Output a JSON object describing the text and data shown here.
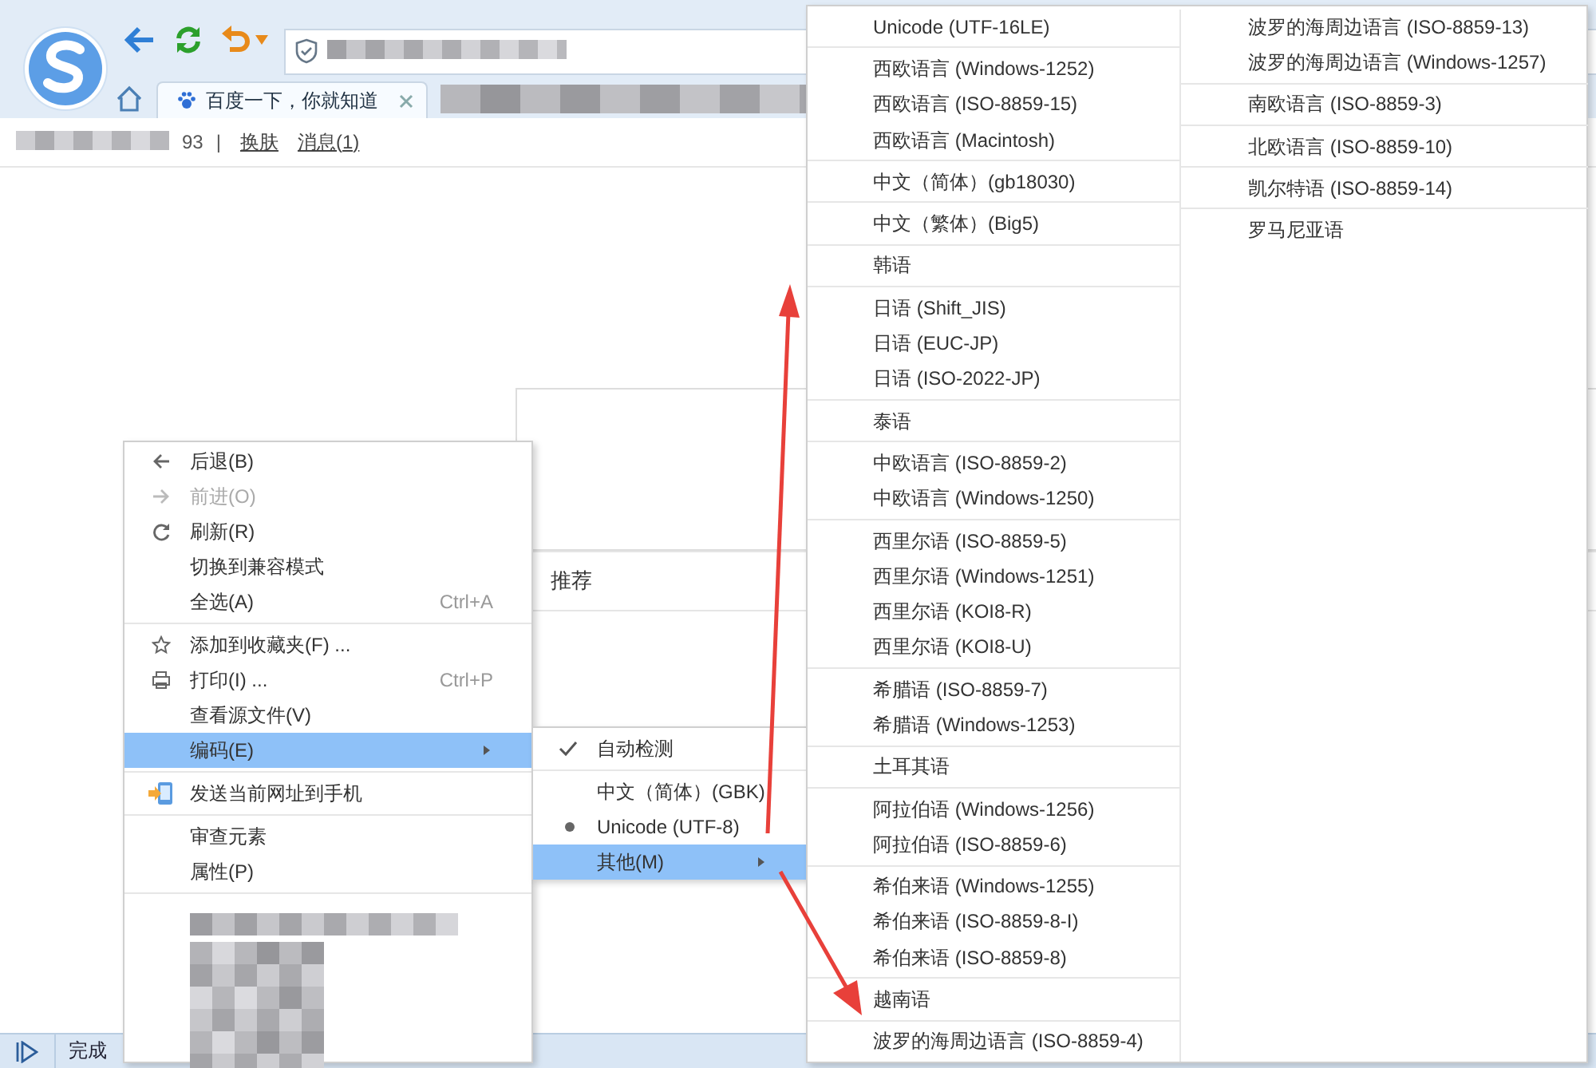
{
  "browser": {
    "tabs": [
      {
        "title": "百度一下，你就知道",
        "selected": true
      }
    ]
  },
  "user_bar": {
    "points": "93",
    "separator": "|",
    "links": [
      "换肤",
      "消息(1)"
    ]
  },
  "page": {
    "section_title": "推荐"
  },
  "context_menu": {
    "groups": [
      [
        {
          "label": "后退(B)",
          "disabled": false,
          "selected": false
        },
        {
          "label": "前进(O)",
          "disabled": true,
          "selected": false
        },
        {
          "label": "刷新(R)",
          "disabled": false,
          "selected": false
        },
        {
          "label": "切换到兼容模式",
          "disabled": false,
          "selected": false
        },
        {
          "label": "全选(A)",
          "shortcut": "Ctrl+A",
          "disabled": false,
          "selected": false
        }
      ],
      [
        {
          "label": "添加到收藏夹(F) ...",
          "disabled": false,
          "selected": false
        },
        {
          "label": "打印(I) ...",
          "shortcut": "Ctrl+P",
          "disabled": false,
          "selected": false
        },
        {
          "label": "查看源文件(V)",
          "disabled": false,
          "selected": false
        },
        {
          "label": "编码(E)",
          "submenu": true,
          "disabled": false,
          "selected": true
        }
      ],
      [
        {
          "label": "发送当前网址到手机",
          "disabled": false,
          "selected": false
        }
      ],
      [
        {
          "label": "审查元素",
          "disabled": false,
          "selected": false
        },
        {
          "label": "属性(P)",
          "disabled": false,
          "selected": false
        }
      ]
    ]
  },
  "encoding_submenu": {
    "groups": [
      [
        {
          "label": "自动检测",
          "kind": "checkbox",
          "checked": true,
          "selected": false
        }
      ],
      [
        {
          "label": "中文（简体）(GBK)",
          "kind": "radio",
          "checked": false,
          "selected": false
        },
        {
          "label": "Unicode (UTF-8)",
          "kind": "radio",
          "checked": true,
          "selected": false
        },
        {
          "label": "其他(M)",
          "kind": "submenu",
          "selected": true
        }
      ]
    ]
  },
  "other_encodings": {
    "columns": [
      [
        [
          "Unicode (UTF-16LE)"
        ],
        [
          "西欧语言 (Windows-1252)",
          "西欧语言 (ISO-8859-15)",
          "西欧语言 (Macintosh)"
        ],
        [
          "中文（简体）(gb18030)"
        ],
        [
          "中文（繁体）(Big5)"
        ],
        [
          "韩语"
        ],
        [
          "日语 (Shift_JIS)",
          "日语 (EUC-JP)",
          "日语 (ISO-2022-JP)"
        ],
        [
          "泰语"
        ],
        [
          "中欧语言 (ISO-8859-2)",
          "中欧语言 (Windows-1250)"
        ],
        [
          "西里尔语 (ISO-8859-5)",
          "西里尔语 (Windows-1251)",
          "西里尔语 (KOI8-R)",
          "西里尔语 (KOI8-U)"
        ],
        [
          "希腊语 (ISO-8859-7)",
          "希腊语 (Windows-1253)"
        ],
        [
          "土耳其语"
        ],
        [
          "阿拉伯语 (Windows-1256)",
          "阿拉伯语 (ISO-8859-6)"
        ],
        [
          "希伯来语 (Windows-1255)",
          "希伯来语 (ISO-8859-8-I)",
          "希伯来语 (ISO-8859-8)"
        ],
        [
          "越南语"
        ],
        [
          "波罗的海周边语言 (ISO-8859-4)"
        ]
      ],
      [
        [
          "波罗的海周边语言 (ISO-8859-13)",
          "波罗的海周边语言 (Windows-1257)"
        ],
        [
          "南欧语言 (ISO-8859-3)"
        ],
        [
          "北欧语言 (ISO-8859-10)"
        ],
        [
          "凯尔特语 (ISO-8859-14)"
        ],
        [
          "罗马尼亚语"
        ]
      ]
    ]
  },
  "status_bar": {
    "text": "完成"
  }
}
